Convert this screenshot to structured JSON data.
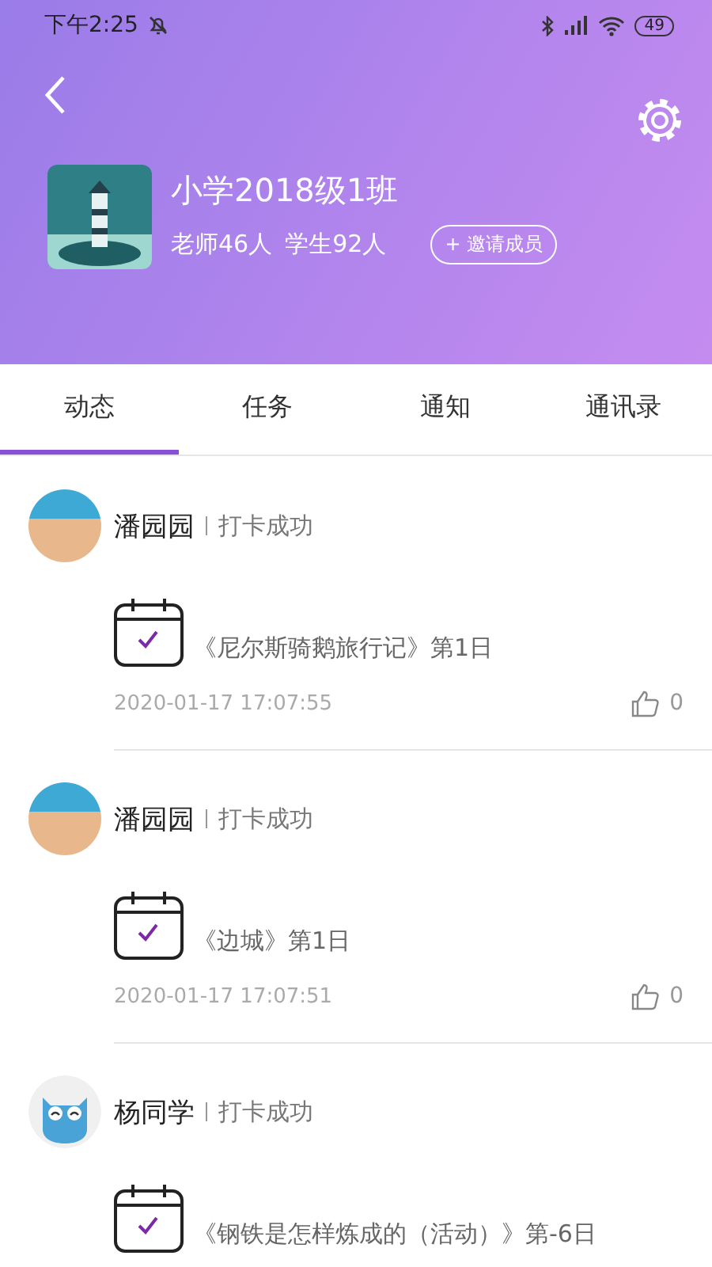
{
  "status_bar": {
    "time": "下午2:25",
    "battery": "49"
  },
  "class_info": {
    "name": "小学2018级1班",
    "teachers": "老师46人",
    "students": "学生92人",
    "invite_button": "+ 邀请成员"
  },
  "tabs": [
    {
      "label": "动态",
      "selected": true
    },
    {
      "label": "任务",
      "selected": false
    },
    {
      "label": "通知",
      "selected": false
    },
    {
      "label": "通讯录",
      "selected": false
    }
  ],
  "posts": [
    {
      "kind": "photo",
      "name": "潘园园",
      "action": "打卡成功",
      "title": "《尼尔斯骑鹅旅行记》第1日",
      "time": "2020-01-17 17:07:55",
      "likes": "0"
    },
    {
      "kind": "photo",
      "name": "潘园园",
      "action": "打卡成功",
      "title": "《边城》第1日",
      "time": "2020-01-17 17:07:51",
      "likes": "0"
    },
    {
      "kind": "owl",
      "name": "杨同学",
      "action": "打卡成功",
      "title": "《钢铁是怎样炼成的（活动）》第-6日"
    }
  ]
}
